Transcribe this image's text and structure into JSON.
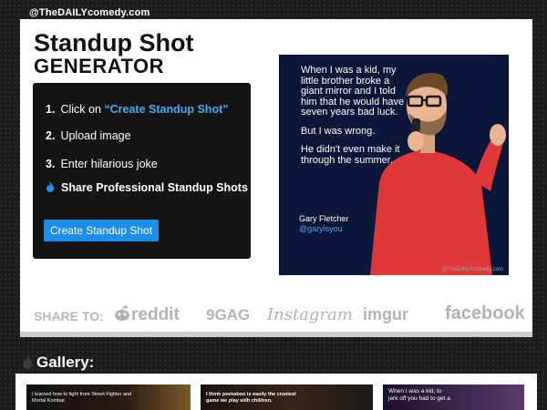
{
  "watermark": "@TheDAILYcomedy.com",
  "title": {
    "line1": "Standup Shot",
    "line2": "GENERATOR"
  },
  "steps": {
    "s1_num": "1.",
    "s1_prefix": "Click on ",
    "s1_link": "“Create Standup Shot”",
    "s2_num": "2.",
    "s2_text": "Upload image",
    "s3_num": "3.",
    "s3_text": "Enter hilarious joke",
    "s4_text": "Share Professional Standup Shots"
  },
  "create_button": "Create Standup Shot",
  "example_shot": {
    "joke_p1": "When I was a kid, my little brother broke a giant mirror and I told him that he would have seven years bad luck.",
    "joke_p2": "But I was wrong.",
    "joke_p3": "He didn't even make it through the summer.",
    "name": "Gary Fletcher",
    "handle": "@garyisyou",
    "watermark": "@TheDAILYcomedy.com"
  },
  "share": {
    "label": "SHARE TO:",
    "sites": [
      "reddit",
      "9GAG",
      "Instagram",
      "imgur",
      "facebook"
    ]
  },
  "gallery": {
    "title": "Gallery:",
    "items": [
      "I learned how to fight from Street Fighter and Mortal Kombat",
      "I think peekaboo is easily the cruelest game we play with children.",
      "When I was a kid, to jerk off you had to get a"
    ]
  },
  "colors": {
    "accent": "#1e8ee8",
    "link": "#4aa8e8",
    "shot_bg": "#0c1638",
    "shirt": "#e0383a"
  }
}
